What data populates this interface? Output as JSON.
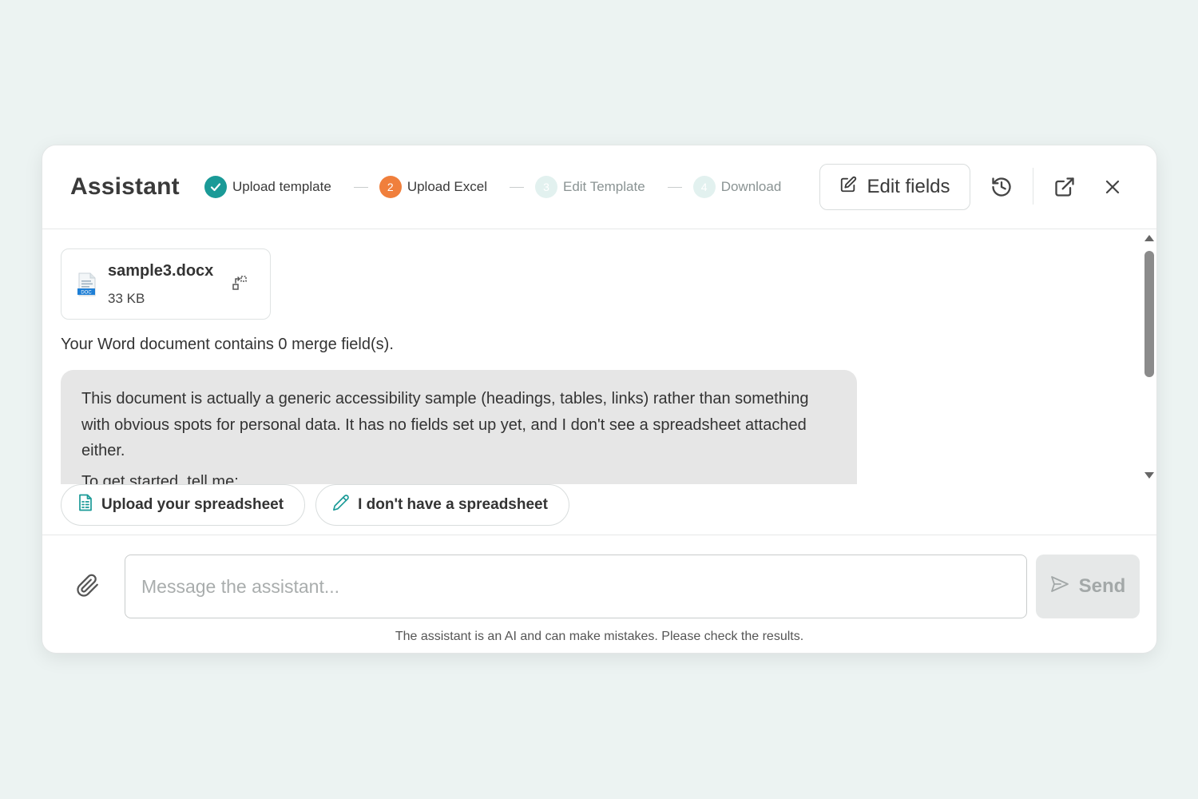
{
  "header": {
    "title": "Assistant",
    "steps": [
      {
        "number": "1",
        "label": "Upload template",
        "state": "done"
      },
      {
        "number": "2",
        "label": "Upload Excel",
        "state": "active"
      },
      {
        "number": "3",
        "label": "Edit Template",
        "state": "pending"
      },
      {
        "number": "4",
        "label": "Download",
        "state": "pending"
      }
    ],
    "edit_fields_label": "Edit fields",
    "icons": {
      "history": "history-icon",
      "open_external": "external-link-icon",
      "close": "close-icon"
    }
  },
  "file": {
    "name": "sample3.docx",
    "size": "33 KB",
    "type_badge": "DOC"
  },
  "messages": {
    "info": "Your Word document contains 0 merge field(s).",
    "assistant_paragraph_1": "This document is actually a generic accessibility sample (headings, tables, links) rather than something with obvious spots for personal data. It has no fields set up yet, and I don't see a spreadsheet attached either.",
    "assistant_paragraph_2": "To get started, tell me:"
  },
  "quick_actions": {
    "upload_spreadsheet": "Upload your spreadsheet",
    "no_spreadsheet": "I don't have a spreadsheet"
  },
  "composer": {
    "placeholder": "Message the assistant...",
    "value": "",
    "send_label": "Send"
  },
  "disclaimer": "The assistant is an AI and can make mistakes. Please check the results.",
  "colors": {
    "accent_teal": "#1a9a97",
    "active_orange": "#f07f3c",
    "pending_step": "#e2f1ef",
    "bubble_bg": "#e6e6e6",
    "page_bg": "#ecf3f2"
  }
}
